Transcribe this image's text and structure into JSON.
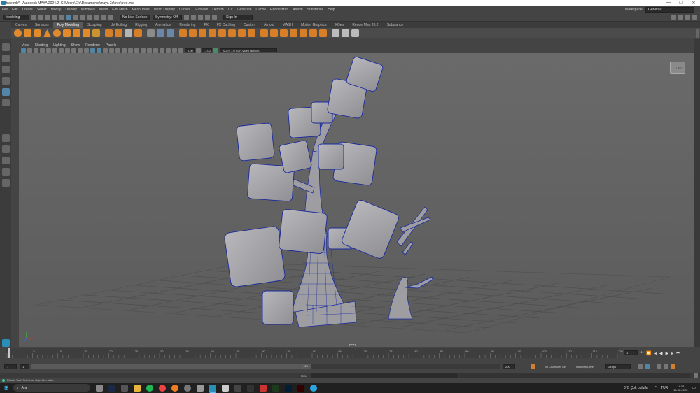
{
  "window": {
    "title": "tree.mb* - Autodesk MAYA 2024.2: C:\\Users\\Efe\\Documents\\maya 3d\\tree\\tree.mb",
    "minimize": "—",
    "maximize": "❐",
    "close": "✕"
  },
  "menubar": [
    "File",
    "Edit",
    "Create",
    "Select",
    "Modify",
    "Display",
    "Windows",
    "Mesh",
    "Edit Mesh",
    "Mesh Tools",
    "Mesh Display",
    "Curves",
    "Surfaces",
    "Deform",
    "UV",
    "Generate",
    "Cache",
    "RenderMan",
    "Arnold",
    "Substance",
    "Help"
  ],
  "workspace": {
    "label": "Workspace:",
    "value": "General*"
  },
  "statusline": {
    "mode": "Modeling",
    "surface": "No Live Surface",
    "symmetry": "Symmetry: Off",
    "signin": "Sign In"
  },
  "shelf_tabs": [
    "Curves",
    "Surfaces",
    "Poly Modeling",
    "Sculpting",
    "UV Editing",
    "Rigging",
    "Animation",
    "Rendering",
    "FX",
    "FX Caching",
    "Custom",
    "Arnold",
    "MASH",
    "Motion Graphics",
    "XGen",
    "RenderMan 26.2",
    "Substance"
  ],
  "shelf_active": "Poly Modeling",
  "panel_menu": [
    "View",
    "Shading",
    "Lighting",
    "Show",
    "Renderer",
    "Panels"
  ],
  "panel_fields": {
    "near": "0.00",
    "far": "1.00",
    "colorspace": "ACES 1.0 SDR-video (sRGB)"
  },
  "viewport": {
    "camera": "persp",
    "viewcube": "LEFT"
  },
  "timeline": {
    "ticks": [
      "0",
      "5",
      "10",
      "15",
      "20",
      "25",
      "30",
      "35",
      "40",
      "45",
      "50",
      "55",
      "60",
      "65",
      "70",
      "75",
      "80",
      "85",
      "90",
      "95",
      "100",
      "105",
      "110",
      "115",
      "120"
    ],
    "current_frame": "1"
  },
  "range": {
    "start": "1",
    "inner_start": "1",
    "inner_end": "120",
    "end": "200",
    "character": "No Character Set",
    "anim_layer": "No Anim Layer",
    "fps": "24 fps"
  },
  "cmdline": {
    "label": "MEL"
  },
  "helpline": "Rotate Tool: Select an object to rotate.",
  "taskbar": {
    "search": "Ara",
    "weather": "3°C  Çok bulutlu",
    "lang": "TUR",
    "time": "14:36",
    "date": "19.02.2025"
  },
  "colors": {
    "accent": "#5285a6",
    "wire": "#1a2aa0",
    "cube": "#a9a9ad"
  }
}
